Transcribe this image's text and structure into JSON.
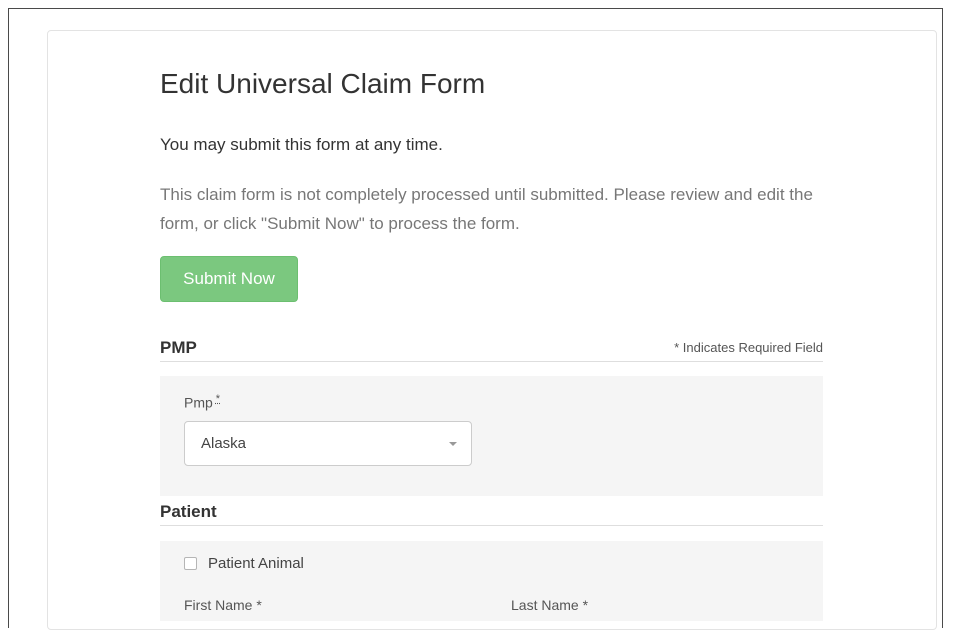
{
  "form": {
    "title": "Edit Universal Claim Form",
    "intro": "You may submit this form at any time.",
    "description": "This claim form is not completely processed until submitted. Please review and edit the form, or click \"Submit Now\" to process the form.",
    "submit_label": "Submit Now",
    "required_note": "* Indicates Required Field",
    "required_marker": "*"
  },
  "sections": {
    "pmp": {
      "title": "PMP",
      "pmp_label": "Pmp",
      "pmp_value": "Alaska"
    },
    "patient": {
      "title": "Patient",
      "animal_label": "Patient Animal",
      "first_name_label": "First Name *",
      "last_name_label": "Last Name *"
    }
  },
  "colors": {
    "submit_button": "#7bc87f",
    "panel_bg": "#f5f5f5"
  }
}
